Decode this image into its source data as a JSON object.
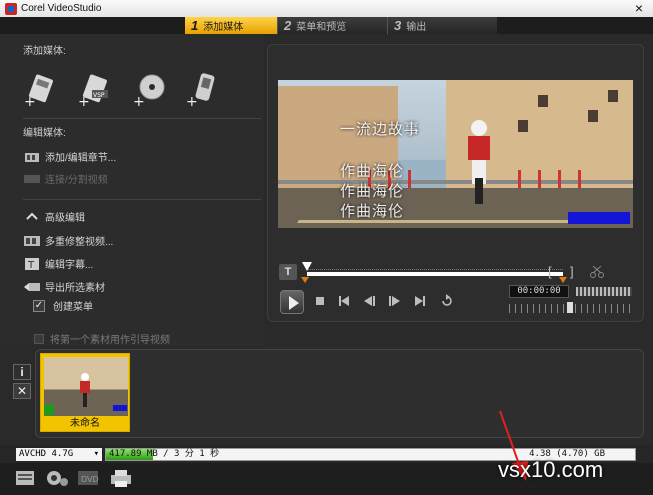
{
  "window": {
    "title": "Corel VideoStudio",
    "close_glyph": "×"
  },
  "steps": [
    {
      "num": "1",
      "label": "添加媒体"
    },
    {
      "num": "2",
      "label": "菜单和预览"
    },
    {
      "num": "3",
      "label": "输出"
    }
  ],
  "left": {
    "add_media": "添加媒体:",
    "capture_icons": [
      "add-video-icon",
      "add-vsp-project-icon",
      "add-disc-icon",
      "add-mobile-device-icon"
    ],
    "edit_media": "编辑媒体:",
    "add_edit_chapter": "添加/编辑章节...",
    "join_split_video": "连接/分割视频",
    "advanced_edit": "高级编辑",
    "multi_trim": "多重修整视频...",
    "edit_subtitles": "编辑字幕...",
    "export_selected": "导出所选素材",
    "create_menu": "创建菜单",
    "use_first_clip": "将第一个素材用作引导视频"
  },
  "preview": {
    "overlay_lines": [
      "一流边故事",
      "作曲海伦",
      "作曲海伦",
      "作曲海伦"
    ],
    "timecode": "00:00:00",
    "trim_in": "[",
    "trim_out": "]"
  },
  "storyboard": {
    "info_btn": "i",
    "delete_btn": "✕",
    "clips": [
      {
        "label": "未命名"
      }
    ]
  },
  "status": {
    "disc_type": "AVCHD 4.7G",
    "usage_text": "417.89 MB / 3 分 1 秒",
    "usage_fraction": 0.089,
    "capacity_text": "4.38 (4.70) GB"
  },
  "watermark": "vsx10.com",
  "colors": {
    "accent": "#f2c400",
    "usage_fill": "#2f9b17",
    "arrow": "#e02020"
  }
}
